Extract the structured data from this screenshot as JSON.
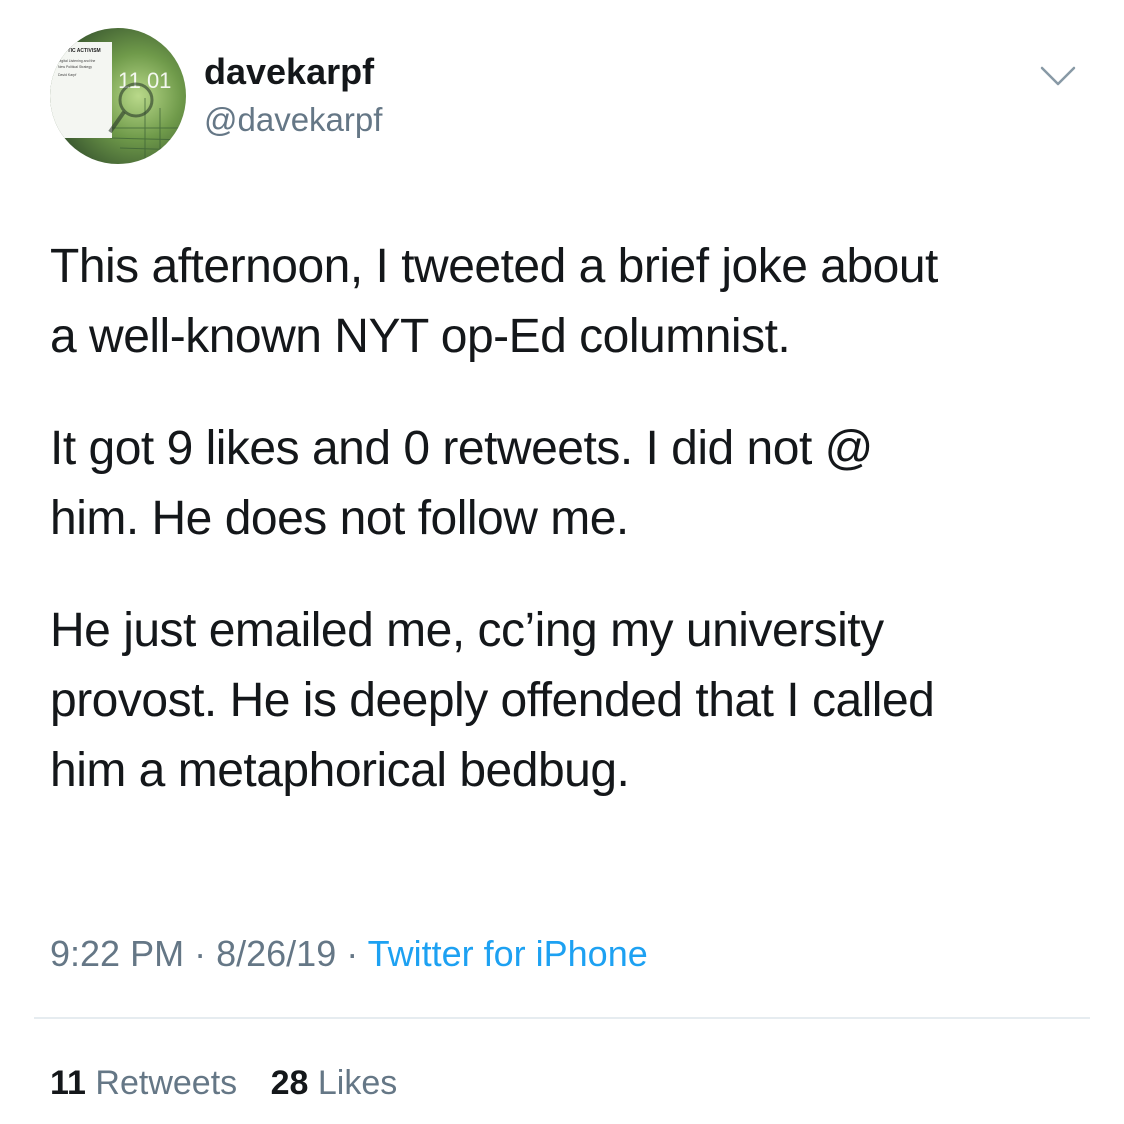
{
  "user": {
    "display_name": "davekarpf",
    "handle": "@davekarpf",
    "avatar_icon": "book-cover-avatar-icon",
    "avatar_book_title": "ALYTIC ACTIVISM",
    "avatar_book_subtitle_1": "Digital Listening and the",
    "avatar_book_subtitle_2": "New Political Strategy",
    "avatar_book_author": "David Karpf",
    "avatar_digits": "11 01"
  },
  "menu": {
    "icon": "chevron-down-icon"
  },
  "tweet": {
    "paragraphs": [
      "This afternoon, I tweeted a brief joke about\na well-known NYT op-Ed columnist.",
      "It got 9 likes and 0 retweets. I did not @\nhim. He does not follow me.",
      "He just emailed me, cc’ing my university\nprovost. He is deeply offended that I called\nhim a metaphorical bedbug."
    ]
  },
  "meta": {
    "time": "9:22 PM",
    "date": "8/26/19",
    "separator": "·",
    "source": "Twitter for iPhone"
  },
  "stats": {
    "retweets_count": "11",
    "retweets_label": "Retweets",
    "likes_count": "28",
    "likes_label": "Likes"
  },
  "colors": {
    "text": "#14171a",
    "secondary": "#657786",
    "accent": "#1da1f2",
    "divider": "#e6ecf0"
  }
}
